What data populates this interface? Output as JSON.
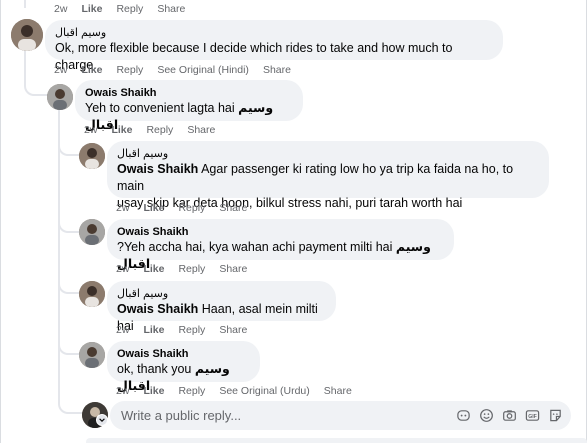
{
  "top_actions": {
    "time": "2w",
    "like": "Like",
    "reply": "Reply",
    "share": "Share"
  },
  "comments": [
    {
      "author": "وسیم اقبال",
      "text": "Ok, more flexible because I decide which rides to take and how much to charge.",
      "actions": {
        "time": "2w",
        "like": "Like",
        "reply": "Reply",
        "see_original": "See Original (Hindi)",
        "share": "Share"
      }
    },
    {
      "author": "Owais Shaikh",
      "text": "Yeh to convenient lagta hai",
      "mention": "وسیم اقبال",
      "actions": {
        "time": "2w",
        "like": "Like",
        "reply": "Reply",
        "share": "Share"
      }
    },
    {
      "author": "وسیم اقبال",
      "mention": "Owais Shaikh",
      "text_line1": "Agar passenger ki rating low ho ya trip ka faida na ho, to main",
      "text_line2": "usay skip kar deta hoon, bilkul stress nahi, puri tarah worth hai",
      "actions": {
        "time": "2w",
        "like": "Like",
        "reply": "Reply",
        "share": "Share"
      }
    },
    {
      "author": "Owais Shaikh",
      "text": "?Yeh accha hai, kya wahan achi payment milti hai",
      "mention": "وسیم اقبال",
      "actions": {
        "time": "2w",
        "like": "Like",
        "reply": "Reply",
        "share": "Share"
      }
    },
    {
      "author": "وسیم اقبال",
      "mention": "Owais Shaikh",
      "text": "Haan, asal mein milti hai",
      "actions": {
        "time": "2w",
        "like": "Like",
        "reply": "Reply",
        "share": "Share"
      }
    },
    {
      "author": "Owais Shaikh",
      "text": "ok, thank you",
      "mention": "وسیم اقبال",
      "actions": {
        "time": "2w",
        "like": "Like",
        "reply": "Reply",
        "see_original": "See Original (Urdu)",
        "share": "Share"
      }
    }
  ],
  "reply_box": {
    "placeholder": "Write a public reply..."
  },
  "icons": [
    "emoji-icon",
    "sticker-icon",
    "camera-icon",
    "gif-icon",
    "sticker-2-icon"
  ]
}
